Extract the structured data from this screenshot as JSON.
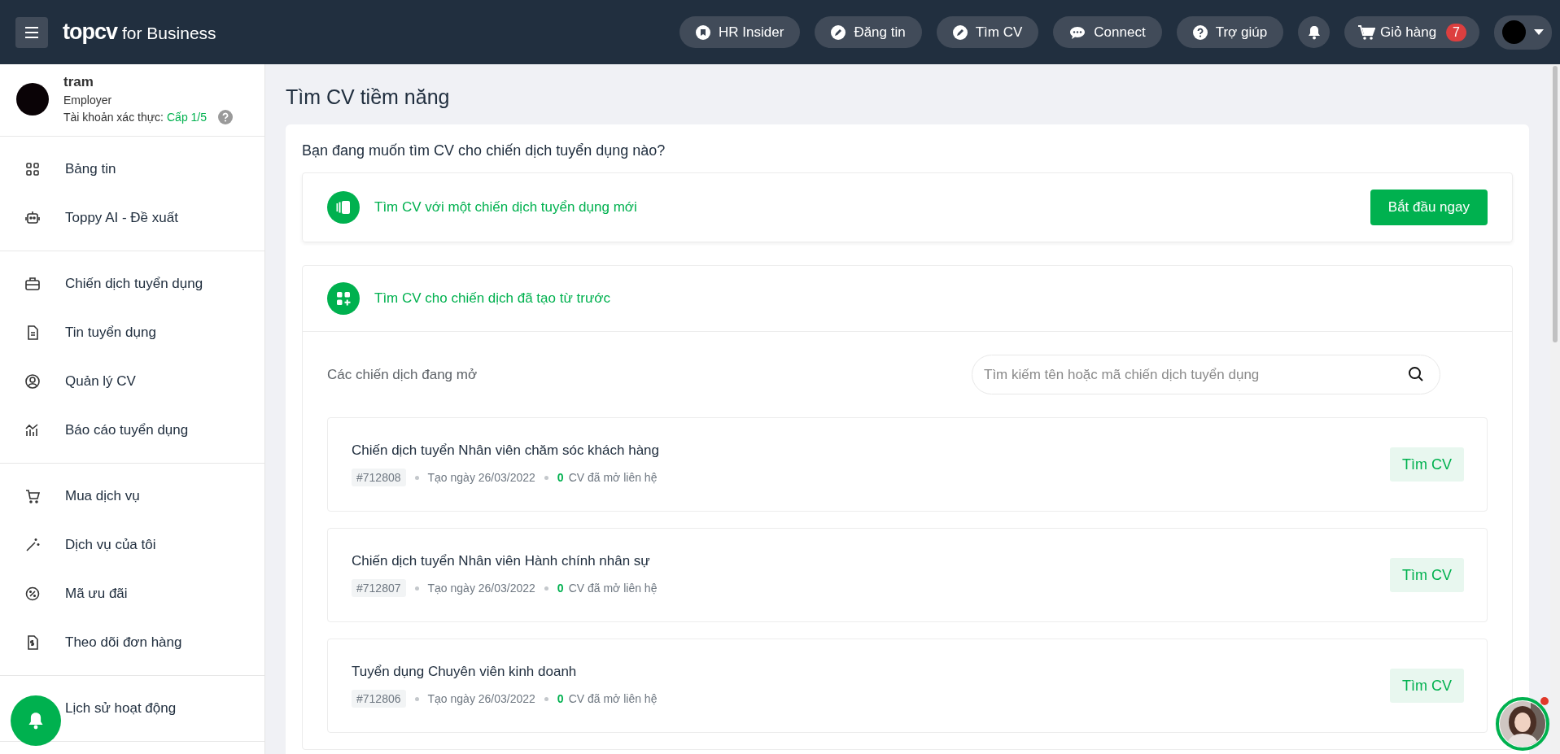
{
  "header": {
    "logo": {
      "brand": "topcv",
      "suffix": "for Business"
    },
    "nav": [
      {
        "label": "HR Insider",
        "kind": "bookmark"
      },
      {
        "label": "Đăng tin",
        "kind": "pencil"
      },
      {
        "label": "Tìm CV",
        "kind": "pencil"
      },
      {
        "label": "Connect",
        "kind": "chat"
      },
      {
        "label": "Trợ giúp",
        "kind": "help"
      }
    ],
    "cart": {
      "label": "Giỏ hàng",
      "badge": "7"
    }
  },
  "profile": {
    "name": "tram",
    "role": "Employer",
    "verify_label": "Tài khoản xác thực:",
    "verify_level": "Cấp 1/5"
  },
  "sidebar": {
    "groups": [
      [
        {
          "label": "Bảng tin",
          "kind": "grid"
        },
        {
          "label": "Toppy AI - Đề xuất",
          "kind": "robot"
        }
      ],
      [
        {
          "label": "Chiến dịch tuyển dụng",
          "kind": "briefcase"
        },
        {
          "label": "Tin tuyển dụng",
          "kind": "document"
        },
        {
          "label": "Quản lý CV",
          "kind": "user"
        },
        {
          "label": "Báo cáo tuyển dụng",
          "kind": "chart"
        }
      ],
      [
        {
          "label": "Mua dịch vụ",
          "kind": "cart"
        },
        {
          "label": "Dịch vụ của tôi",
          "kind": "wand"
        },
        {
          "label": "Mã ưu đãi",
          "kind": "discount"
        },
        {
          "label": "Theo dõi đơn hàng",
          "kind": "receipt"
        }
      ],
      [
        {
          "label": "Lịch sử hoạt động"
        }
      ]
    ]
  },
  "page_title": "Tìm CV tiềm năng",
  "question": "Bạn đang muốn tìm CV cho chiến dịch tuyển dụng nào?",
  "new_campaign": {
    "label": "Tìm CV với một chiến dịch tuyển dụng mới",
    "button": "Bắt đầu ngay"
  },
  "existing": {
    "label": "Tìm CV cho chiến dịch đã tạo từ trước",
    "list_title": "Các chiến dịch đang mở",
    "search": {
      "placeholder": "Tìm kiếm tên hoặc mã chiến dịch tuyển dụng"
    },
    "campaigns": [
      {
        "title": "Chiến dịch tuyển Nhân viên chăm sóc khách hàng",
        "code": "#712808",
        "created": "Tạo ngày 26/03/2022",
        "count": "0",
        "count_label": "CV đã mở liên hệ",
        "button": "Tìm CV"
      },
      {
        "title": "Chiến dịch tuyển Nhân viên Hành chính nhân sự",
        "code": "#712807",
        "created": "Tạo ngày 26/03/2022",
        "count": "0",
        "count_label": "CV đã mở liên hệ",
        "button": "Tìm CV"
      },
      {
        "title": "Tuyển dụng Chuyên viên kinh doanh",
        "code": "#712806",
        "created": "Tạo ngày 26/03/2022",
        "count": "0",
        "count_label": "CV đã mở liên hệ",
        "button": "Tìm CV"
      }
    ]
  }
}
